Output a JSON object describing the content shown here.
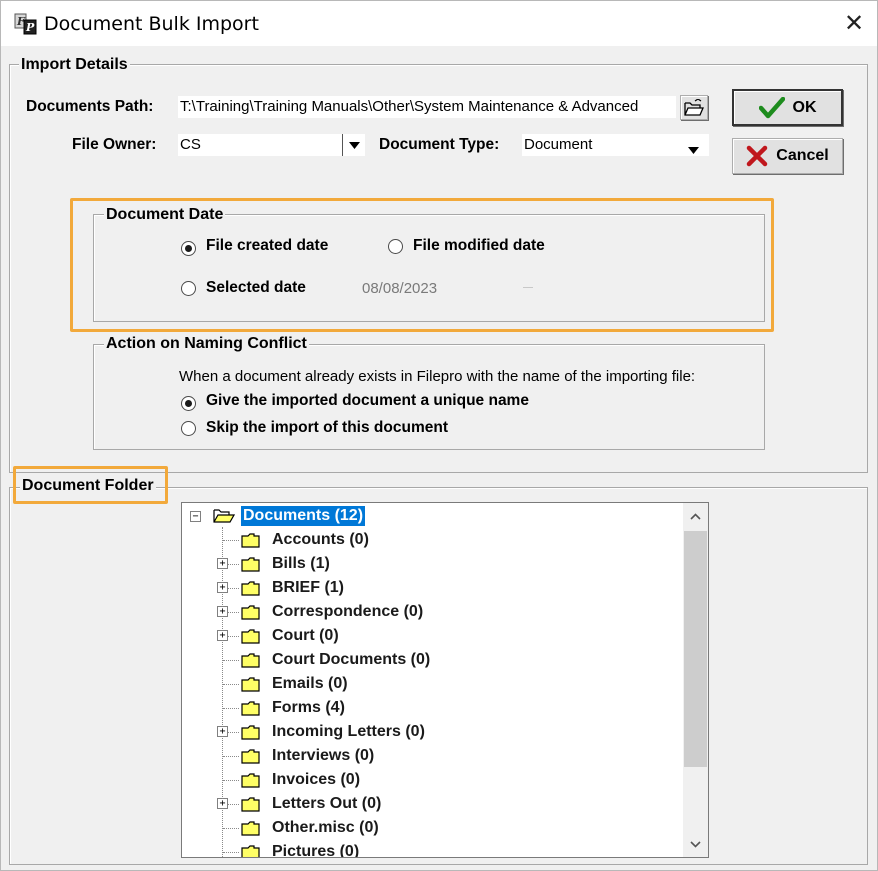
{
  "window": {
    "title": "Document Bulk Import",
    "close_glyph": "✕"
  },
  "import_details": {
    "legend": "Import Details",
    "documents_path_label": "Documents Path:",
    "documents_path_value": "T:\\Training\\Training Manuals\\Other\\System Maintenance & Advanced",
    "file_owner_label": "File Owner:",
    "file_owner_value": "CS",
    "document_type_label": "Document Type:",
    "document_type_value": "Document"
  },
  "buttons": {
    "ok_label": "OK",
    "cancel_label": "Cancel"
  },
  "document_date": {
    "legend": "Document Date",
    "file_created_label": "File created date",
    "file_modified_label": "File modified date",
    "selected_date_label": "Selected date",
    "selected_date_value": "08/08/2023",
    "selected_option": "file_created"
  },
  "naming_conflict": {
    "legend": "Action on Naming Conflict",
    "description": "When a document already exists in Filepro with the name of the importing file:",
    "unique_name_label": "Give the imported document a unique name",
    "skip_label": "Skip the import of this document",
    "selected_option": "unique_name"
  },
  "document_folder": {
    "legend": "Document Folder",
    "root": {
      "label": "Documents (12)",
      "expanded": true,
      "selected": true
    },
    "children": [
      {
        "label": "Accounts (0)",
        "expandable": false
      },
      {
        "label": "Bills (1)",
        "expandable": true
      },
      {
        "label": "BRIEF (1)",
        "expandable": true
      },
      {
        "label": "Correspondence (0)",
        "expandable": true
      },
      {
        "label": "Court (0)",
        "expandable": true
      },
      {
        "label": "Court Documents (0)",
        "expandable": false
      },
      {
        "label": "Emails (0)",
        "expandable": false
      },
      {
        "label": "Forms (4)",
        "expandable": false
      },
      {
        "label": "Incoming Letters (0)",
        "expandable": true
      },
      {
        "label": "Interviews (0)",
        "expandable": false
      },
      {
        "label": "Invoices (0)",
        "expandable": false
      },
      {
        "label": "Letters Out (0)",
        "expandable": true
      },
      {
        "label": "Other.misc (0)",
        "expandable": false
      },
      {
        "label": "Pictures (0)",
        "expandable": false
      }
    ]
  },
  "colors": {
    "highlight": "#f2a93b",
    "selection": "#0078d7",
    "folder_fill": "#ffff66"
  },
  "icons": {
    "app": "filepro-app-icon",
    "browse": "folder-open-icon",
    "ok": "checkmark-icon",
    "cancel": "x-icon",
    "dropdown": "dropdown-arrow-icon",
    "folder": "folder-icon"
  }
}
